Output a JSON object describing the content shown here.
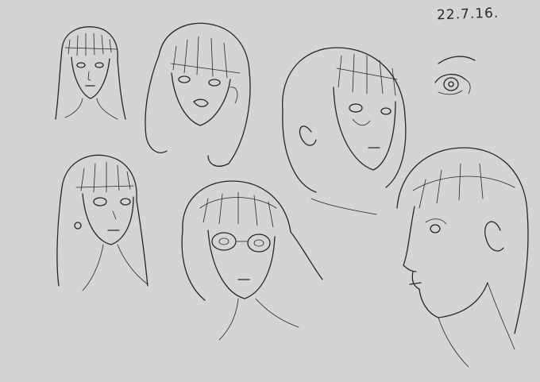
{
  "sheet": {
    "date_note": "22.7.16.",
    "paper_color": "#d4d4d4",
    "ink_color": "#262626"
  }
}
